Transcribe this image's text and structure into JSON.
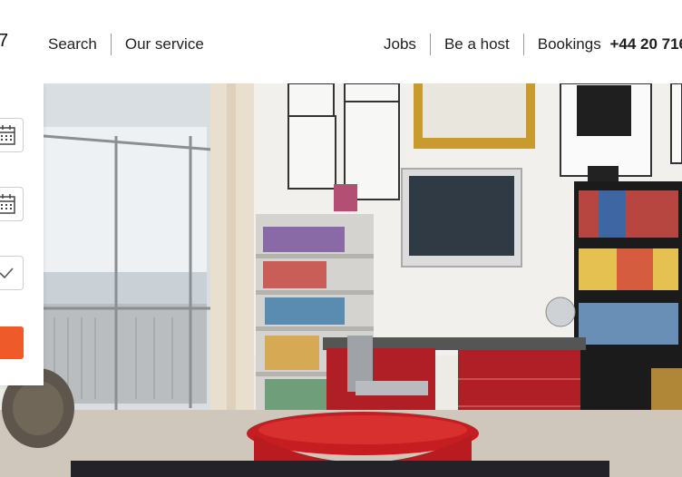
{
  "logo": {
    "fragment": "7"
  },
  "nav": {
    "left": [
      "Search",
      "Our service"
    ],
    "jobs": "Jobs",
    "host": "Be a host",
    "bookings": "Bookings",
    "phone": "+44 20 716"
  },
  "booking_panel": {
    "checkin_icon": "calendar-icon",
    "checkout_icon": "calendar-icon",
    "guests_icon": "chevron-down-icon",
    "submit_color": "#ef5a2b"
  },
  "hero": {
    "image": "loft-apartment-photo"
  }
}
